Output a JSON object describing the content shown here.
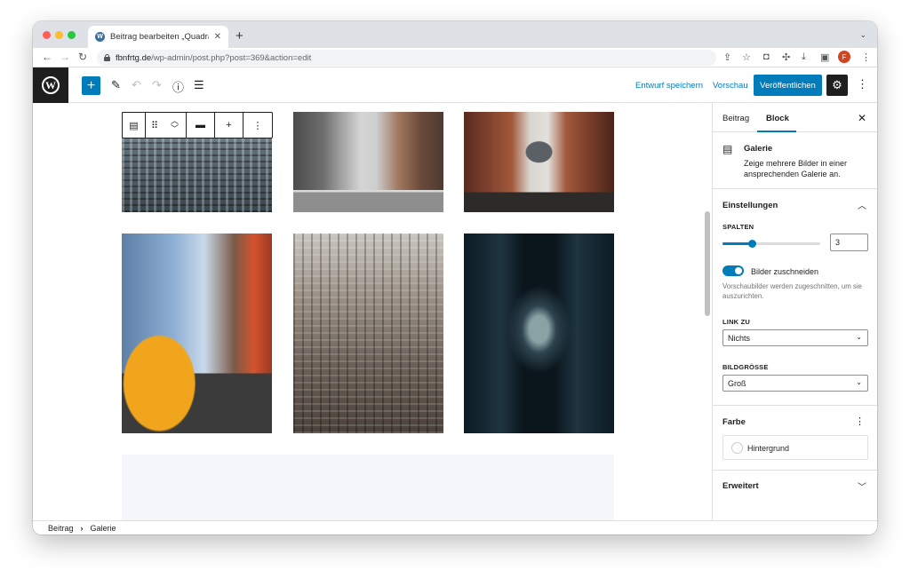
{
  "browser": {
    "tab_title": "Beitrag bearbeiten „Quadratisc",
    "tab_favicon_text": "W",
    "url_host": "fbnfrtg.de",
    "url_path": "/wp-admin/post.php?post=369&action=edit",
    "profile_initial": "F"
  },
  "header": {
    "logo_text": "W",
    "save_draft": "Entwurf speichern",
    "preview": "Vorschau",
    "publish": "Veröffentlichen"
  },
  "sidebar": {
    "tab_post": "Beitrag",
    "tab_block": "Block",
    "block_name": "Galerie",
    "block_description": "Zeige mehrere Bilder in einer ansprechenden Galerie an.",
    "settings_heading": "Einstellungen",
    "columns_label": "SPALTEN",
    "columns_value": "3",
    "columns_fraction": 0.3,
    "crop_toggle_label": "Bilder zuschneiden",
    "crop_toggle_on": true,
    "crop_help": "Vorschaubilder werden zugeschnitten, um sie auszurichten.",
    "link_label": "LINK ZU",
    "link_value": "Nichts",
    "size_label": "BILDGRÖSSE",
    "size_value": "Groß",
    "color_heading": "Farbe",
    "background_label": "Hintergrund",
    "advanced_heading": "Erweitert"
  },
  "breadcrumb": {
    "root": "Beitrag",
    "current": "Galerie"
  },
  "colors": {
    "accent": "#007cba",
    "dark": "#1e1e1e"
  }
}
